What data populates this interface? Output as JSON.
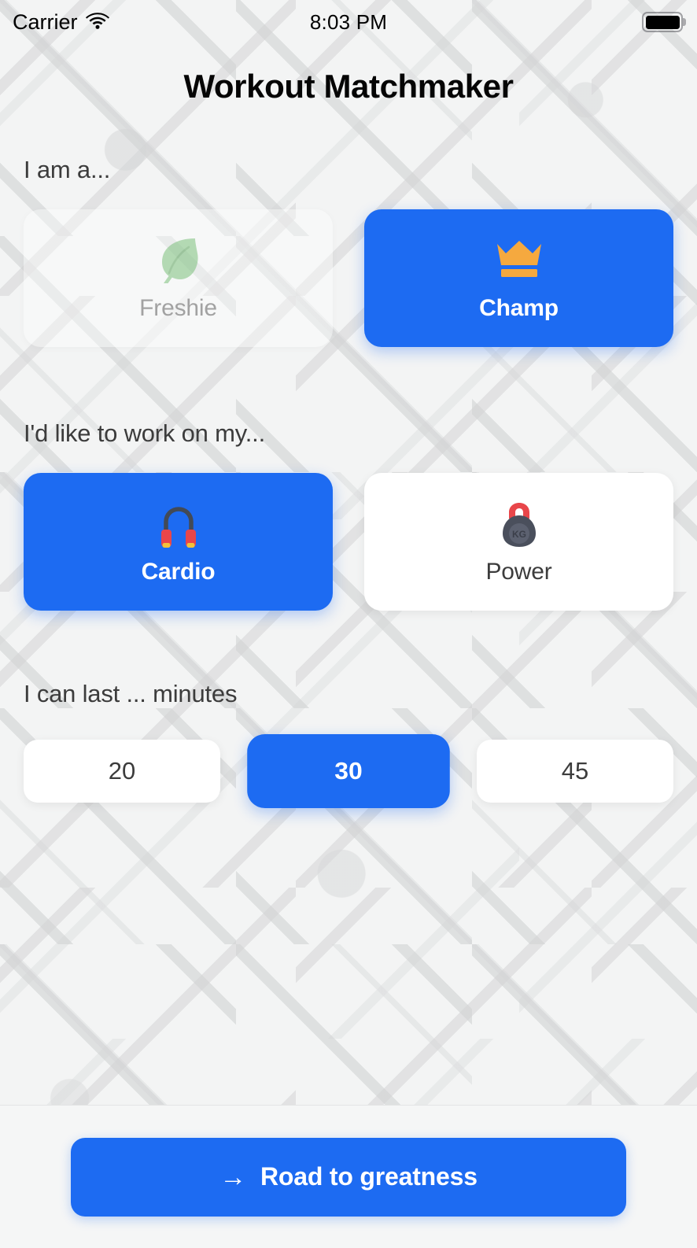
{
  "status_bar": {
    "carrier": "Carrier",
    "wifi_icon": "wifi-icon",
    "time": "8:03 PM",
    "battery_icon": "battery-full-icon"
  },
  "header": {
    "title": "Workout Matchmaker"
  },
  "sections": [
    {
      "label": "I am a...",
      "options": [
        {
          "label": "Freshie",
          "icon": "leaf-icon",
          "selected": false
        },
        {
          "label": "Champ",
          "icon": "crown-icon",
          "selected": true
        }
      ]
    },
    {
      "label": "I'd like to work on my...",
      "options": [
        {
          "label": "Cardio",
          "icon": "jump-rope-icon",
          "selected": true
        },
        {
          "label": "Power",
          "icon": "kettlebell-icon",
          "selected": false
        }
      ]
    },
    {
      "label": "I can last ... minutes",
      "options": [
        {
          "label": "20",
          "selected": false
        },
        {
          "label": "30",
          "selected": true
        },
        {
          "label": "45",
          "selected": false
        }
      ]
    }
  ],
  "footer": {
    "cta_arrow": "→",
    "cta_label": "Road to greatness"
  },
  "colors": {
    "accent_blue": "#1d6bf2",
    "crown_orange": "#f5a93f",
    "leaf_green": "#7cc07c",
    "handle_red": "#e8464a",
    "kettlebell_gray": "#4a4f5c",
    "page_background": "#f3f4f4",
    "card_white": "#ffffff",
    "label_gray": "#3c3c3c",
    "muted_gray": "#a2a2a2"
  }
}
